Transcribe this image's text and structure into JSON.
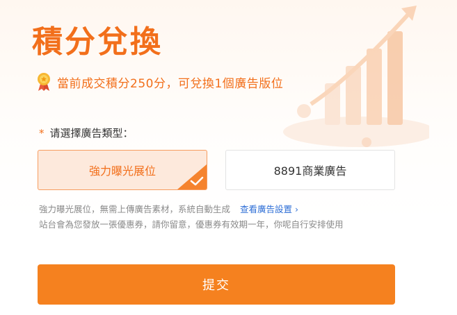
{
  "dialog": {
    "title": "積分兌換",
    "info_text": "當前成交積分250分，可兌換1個廣告版位"
  },
  "form": {
    "required_mark": "*",
    "type_label": "请選擇廣告類型：",
    "options": [
      {
        "label": "強力曝光展位",
        "selected": true
      },
      {
        "label": "8891商業廣告",
        "selected": false
      }
    ],
    "note_line1": "強力曝光展位，無需上傳廣告素材，系統自動生成",
    "link_text": "查看廣告設置",
    "link_chevron": "›",
    "note_line2": "站台會為您發放一張優惠券，請你留意，優惠券有效期一年，你呢自行安排使用",
    "submit_label": "提交"
  },
  "colors": {
    "accent": "#f26f1b",
    "selected_bg": "#fde9dc",
    "link": "#2f6fd6",
    "button": "#f5811f"
  },
  "icons": {
    "medal": "medal-icon",
    "check": "check-icon",
    "chevron": "chevron-right-icon"
  }
}
